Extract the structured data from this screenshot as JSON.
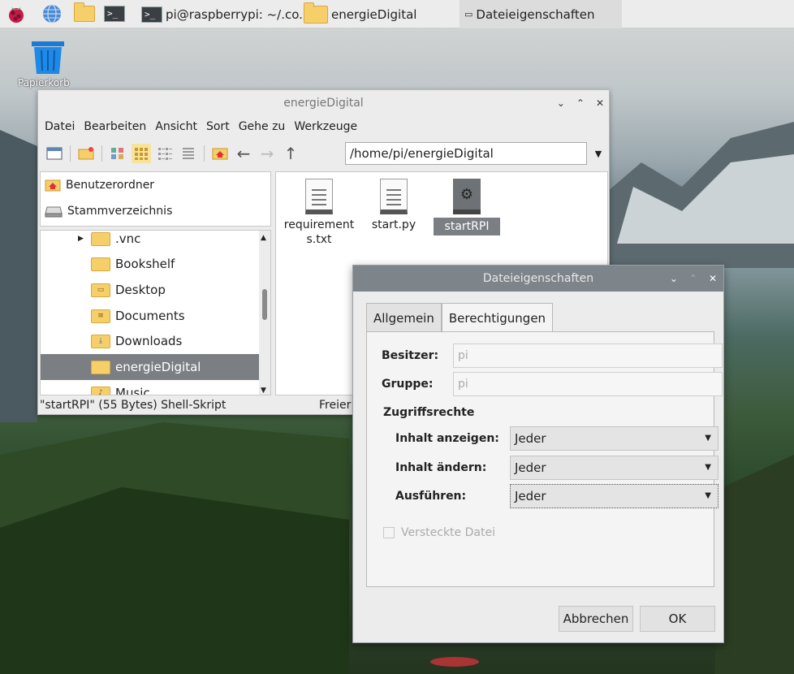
{
  "taskbar": {
    "items": [
      {
        "label": "pi@raspberrypi: ~/.co..."
      },
      {
        "label": "energieDigital"
      },
      {
        "label": "Dateieigenschaften"
      }
    ]
  },
  "desktop": {
    "trash_label": "Papierkorb"
  },
  "file_manager": {
    "title": "energieDigital",
    "menu": [
      "Datei",
      "Bearbeiten",
      "Ansicht",
      "Sort",
      "Gehe zu",
      "Werkzeuge"
    ],
    "address": "/home/pi/energieDigital",
    "places": [
      "Benutzerordner",
      "Stammverzeichnis"
    ],
    "tree": [
      ".vnc",
      "Bookshelf",
      "Desktop",
      "Documents",
      "Downloads",
      "energieDigital",
      "Music"
    ],
    "selected_tree_item": "energieDigital",
    "files": [
      {
        "name": "requirements.txt",
        "name_line1": "requirement",
        "name_line2": "s.txt",
        "icon": "text-file-icon"
      },
      {
        "name": "start.py",
        "icon": "text-file-icon"
      },
      {
        "name": "startRPI",
        "icon": "script-file-icon",
        "selected": true
      }
    ],
    "status": "\"startRPI\" (55 Bytes) Shell-Skript",
    "status_free": "Freier"
  },
  "dialog": {
    "title": "Dateieigenschaften",
    "tabs": [
      "Allgemein",
      "Berechtigungen"
    ],
    "active_tab": "Berechtigungen",
    "owner_label": "Besitzer:",
    "owner_value": "pi",
    "group_label": "Gruppe:",
    "group_value": "pi",
    "section": "Zugriffsrechte",
    "view_label": "Inhalt anzeigen:",
    "view_value": "Jeder",
    "change_label": "Inhalt ändern:",
    "change_value": "Jeder",
    "exec_label": "Ausführen:",
    "exec_value": "Jeder",
    "hidden_label": "Versteckte Datei",
    "hidden_checked": false,
    "cancel_label": "Abbrechen",
    "ok_label": "OK"
  },
  "colors": {
    "selection": "#7b7f83",
    "dialog_titlebar": "#7d848a",
    "folder": "#f6cf6b"
  }
}
